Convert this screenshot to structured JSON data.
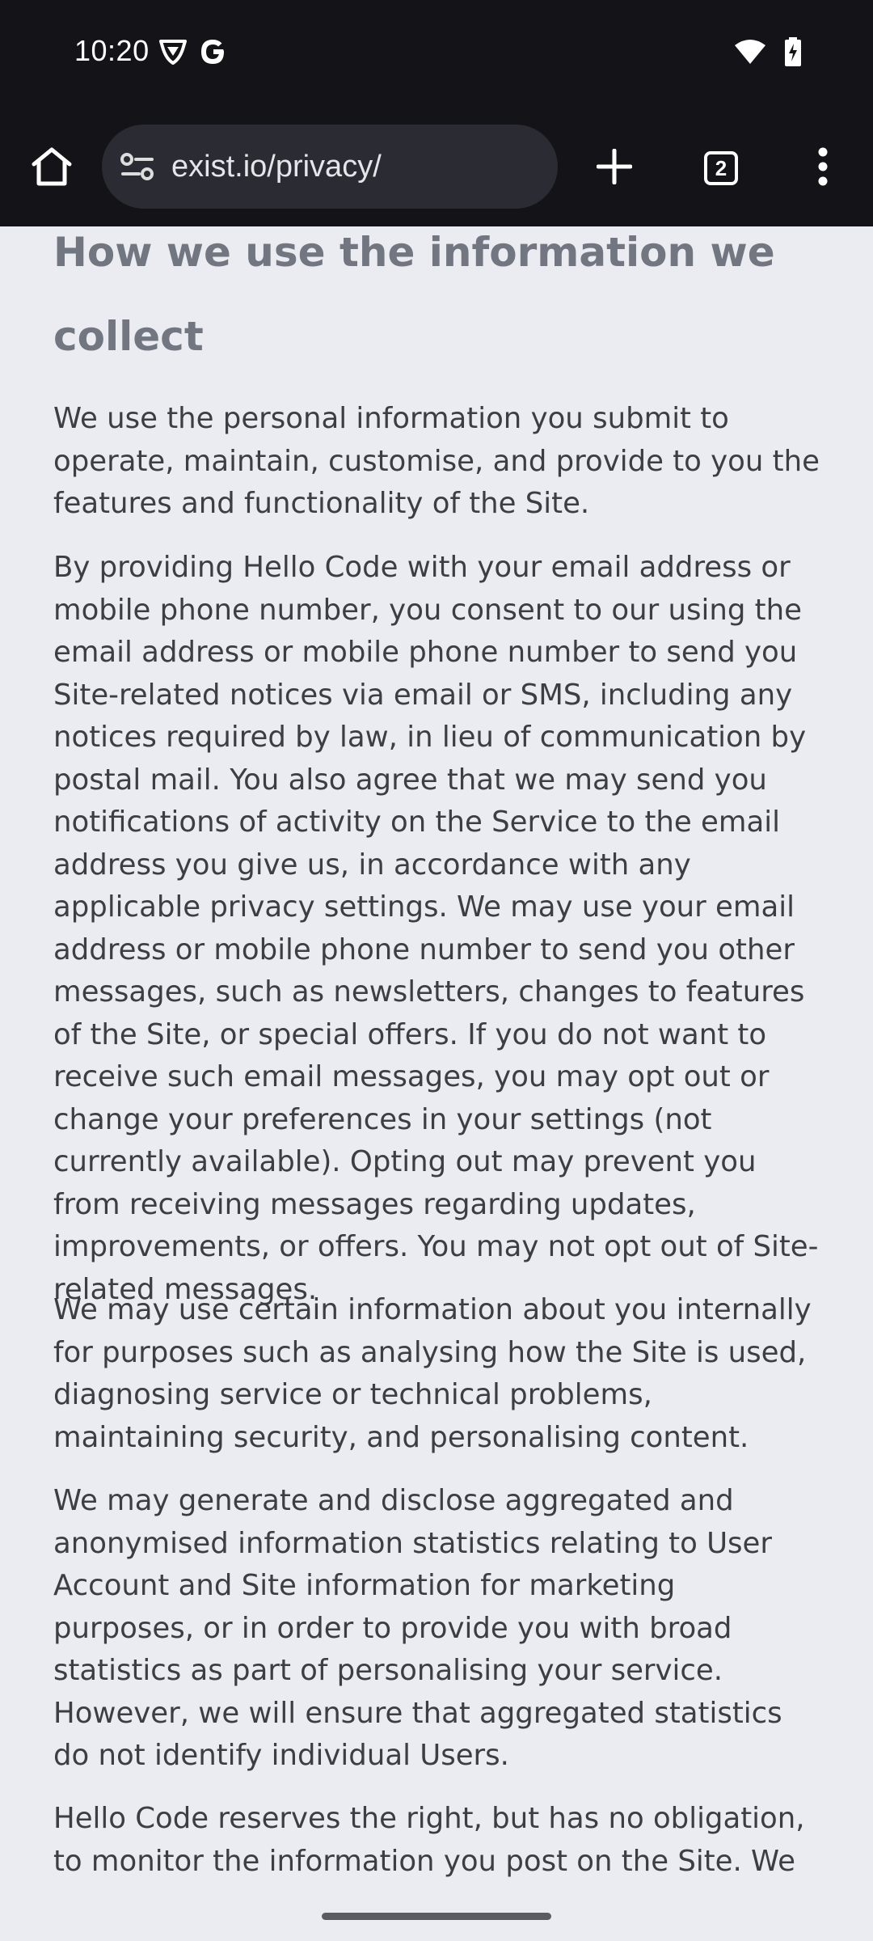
{
  "status_bar": {
    "time": "10:20",
    "left_icons": [
      "vpn-shield-icon",
      "google-icon"
    ],
    "right_icons": [
      "wifi-icon",
      "battery-charging-icon"
    ]
  },
  "browser": {
    "url": "exist.io/privacy/",
    "tab_count": "2",
    "icons": [
      "home-icon",
      "site-settings-icon",
      "new-tab-icon",
      "tab-switcher-icon",
      "more-menu-icon"
    ]
  },
  "page": {
    "heading": "How we use the information we collect",
    "paragraphs": [
      "We use the personal information you submit to operate, maintain, customise, and provide to you the features and functionality of the Site.",
      "By providing Hello Code with your email address or mobile phone number, you consent to our using the email address or mobile phone number to send you Site-related notices via email or SMS, including any notices required by law, in lieu of communication by postal mail. You also agree that we may send you notifications of activity on the Service to the email address you give us, in accordance with any applicable privacy settings. We may use your email address or mobile phone number to send you other messages, such as newsletters, changes to features of the Site, or special offers. If you do not want to receive such email messages, you may opt out or change your preferences in your settings (not currently available). Opting out may prevent you from receiving messages regarding updates, improvements, or offers. You may not opt out of Site-related messages.",
      "We may use certain information about you internally for purposes such as analysing how the Site is used, diagnosing service or technical problems, maintaining security, and personalising content.",
      "We may generate and disclose aggregated and anonymised information statistics relating to User Account and Site information for marketing purposes, or in order to provide you with broad statistics as part of personalising your service. However, we will ensure that aggregated statistics do not identify individual Users.",
      "Hello Code reserves the right, but has no obligation, to monitor the information you post on the Site. We"
    ]
  }
}
